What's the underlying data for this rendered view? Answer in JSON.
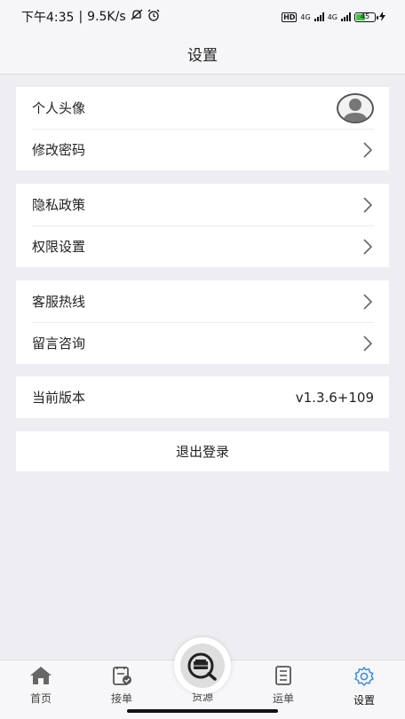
{
  "status_bar": {
    "time": "下午4:35",
    "speed": "9.5K/s",
    "hd": "HD",
    "net1": "4G",
    "net2": "4G",
    "battery": "45"
  },
  "header": {
    "title": "设置"
  },
  "groups": [
    {
      "rows": [
        {
          "label": "个人头像"
        },
        {
          "label": "修改密码"
        }
      ]
    },
    {
      "rows": [
        {
          "label": "隐私政策"
        },
        {
          "label": "权限设置"
        }
      ]
    },
    {
      "rows": [
        {
          "label": "客服热线"
        },
        {
          "label": "留言咨询"
        }
      ]
    },
    {
      "rows": [
        {
          "label": "当前版本",
          "value": "v1.3.6+109"
        }
      ]
    }
  ],
  "logout_label": "退出登录",
  "bottom_nav": {
    "items": [
      {
        "label": "首页",
        "icon": "home-icon"
      },
      {
        "label": "接单",
        "icon": "order-icon"
      },
      {
        "label": "货源",
        "icon": "cargo-icon"
      },
      {
        "label": "运单",
        "icon": "waybill-icon"
      },
      {
        "label": "设置",
        "icon": "gear-icon"
      }
    ],
    "active": "设置",
    "active_color": "#3a8be0"
  }
}
